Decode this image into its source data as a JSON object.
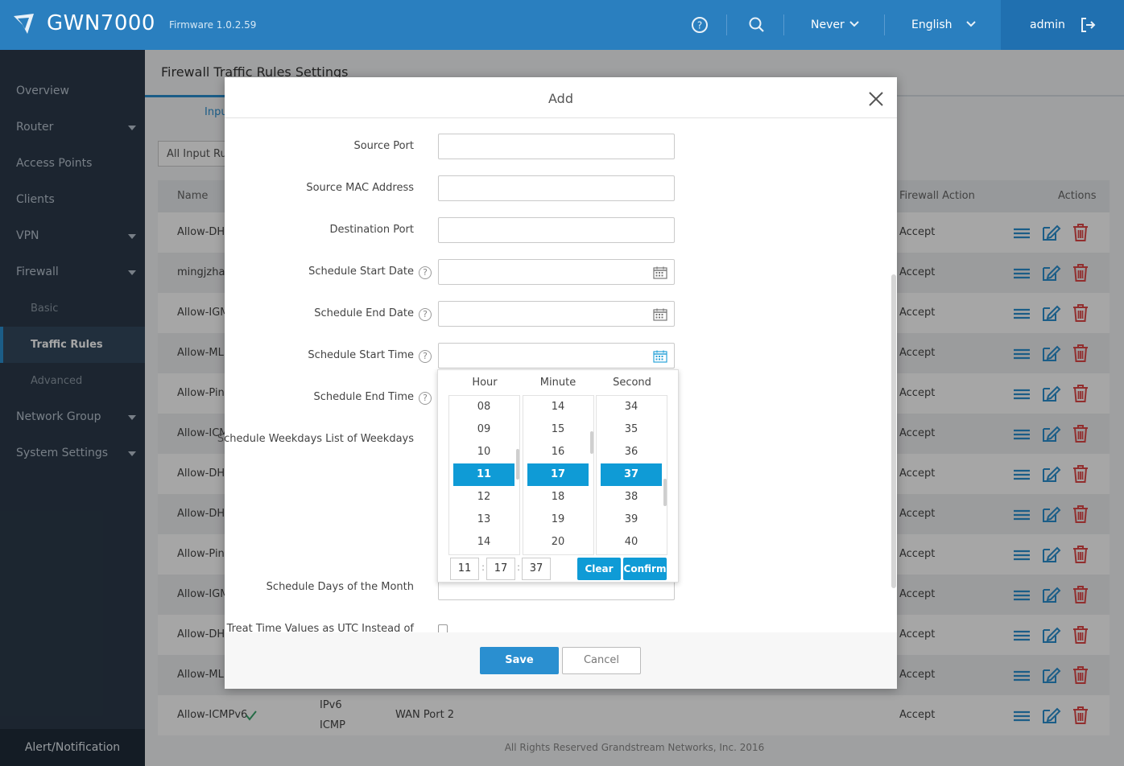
{
  "header": {
    "brand": "GWN7000",
    "firmware": "Firmware 1.0.2.59",
    "timeout": "Never",
    "language": "English",
    "user": "admin"
  },
  "sidebar": {
    "items": [
      {
        "label": "Overview"
      },
      {
        "label": "Router"
      },
      {
        "label": "Access Points"
      },
      {
        "label": "Clients"
      },
      {
        "label": "VPN"
      },
      {
        "label": "Firewall"
      },
      {
        "label": "Basic"
      },
      {
        "label": "Traffic Rules"
      },
      {
        "label": "Advanced"
      },
      {
        "label": "Network Group"
      },
      {
        "label": "System Settings"
      }
    ],
    "alert": "Alert/Notification"
  },
  "main": {
    "title": "Firewall Traffic Rules Settings",
    "tab": "Inpu",
    "filter": "All Input Ru",
    "columns": {
      "name": "Name",
      "action": "Firewall Action",
      "actions": "Actions"
    },
    "rows": [
      {
        "name": "Allow-DHC",
        "action": "Accept"
      },
      {
        "name": "mingjzhar",
        "action": "Accept"
      },
      {
        "name": "Allow-IGM",
        "action": "Accept"
      },
      {
        "name": "Allow-MLD",
        "action": "Accept"
      },
      {
        "name": "Allow-Ping",
        "action": "Accept"
      },
      {
        "name": "Allow-ICM",
        "action": "Accept"
      },
      {
        "name": "Allow-DHC",
        "action": "Accept"
      },
      {
        "name": "Allow-DHC",
        "action": "Accept"
      },
      {
        "name": "Allow-Ping",
        "action": "Accept"
      },
      {
        "name": "Allow-IGM",
        "action": "Accept"
      },
      {
        "name": "Allow-DHC",
        "action": "Accept"
      },
      {
        "name": "Allow-MLD",
        "action": "Accept"
      },
      {
        "name": "Allow-ICMPv6",
        "protocol": "IPv6",
        "protocol2": "ICMP",
        "interface": "WAN Port 2",
        "action": "Accept"
      }
    ],
    "footer": "All Rights Reserved Grandstream Networks, Inc. 2016"
  },
  "modal": {
    "title": "Add",
    "fields": {
      "source_port": "Source Port",
      "source_mac": "Source MAC Address",
      "destination_port": "Destination Port",
      "start_date": "Schedule Start Date",
      "end_date": "Schedule End Date",
      "start_time": "Schedule Start Time",
      "end_time": "Schedule End Time",
      "weekdays": "Schedule Weekdays List of Weekdays",
      "days_of_month": "Schedule Days of the Month",
      "utc": "Treat Time Values as UTC Instead of"
    },
    "help": "?",
    "save": "Save",
    "cancel": "Cancel"
  },
  "picker": {
    "headers": {
      "hour": "Hour",
      "minute": "Minute",
      "second": "Second"
    },
    "hours": [
      "08",
      "09",
      "10",
      "11",
      "12",
      "13",
      "14"
    ],
    "minutes": [
      "14",
      "15",
      "16",
      "17",
      "18",
      "19",
      "20"
    ],
    "seconds": [
      "34",
      "35",
      "36",
      "37",
      "38",
      "39",
      "40"
    ],
    "selected": {
      "hour": "11",
      "minute": "17",
      "second": "37"
    },
    "colon": ":",
    "clear": "Clear",
    "confirm": "Confirm"
  },
  "colors": {
    "accent": "#2a8fd0",
    "topbar": "#2a7fbf",
    "sidebar": "#2b3a4a",
    "delete": "#e04848",
    "picker_selected": "#0f9bd6"
  }
}
